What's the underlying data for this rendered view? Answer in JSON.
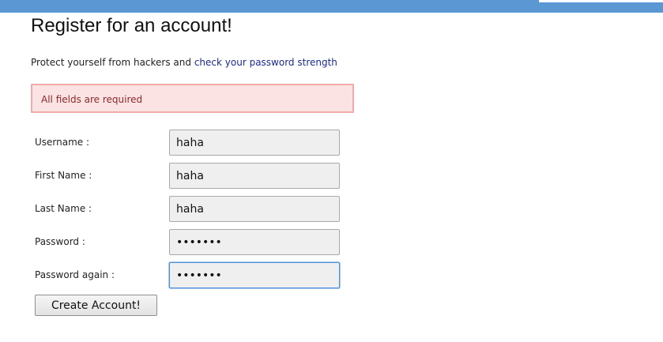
{
  "header": {
    "bar_color": "#5b97d2"
  },
  "page": {
    "title": "Register for an account!",
    "intro_text": "Protect yourself from hackers and ",
    "intro_link": "check your password strength"
  },
  "alert": {
    "message": "All fields are required",
    "background": "#fce3e3",
    "border": "#f3aaaa"
  },
  "form": {
    "username": {
      "label": "Username :",
      "value": "haha"
    },
    "first_name": {
      "label": "First Name :",
      "value": "haha"
    },
    "last_name": {
      "label": "Last Name :",
      "value": "haha"
    },
    "password": {
      "label": "Password :",
      "value": "haha123"
    },
    "password_again": {
      "label": "Password again :",
      "value": "haha123"
    },
    "submit_label": "Create Account!"
  }
}
